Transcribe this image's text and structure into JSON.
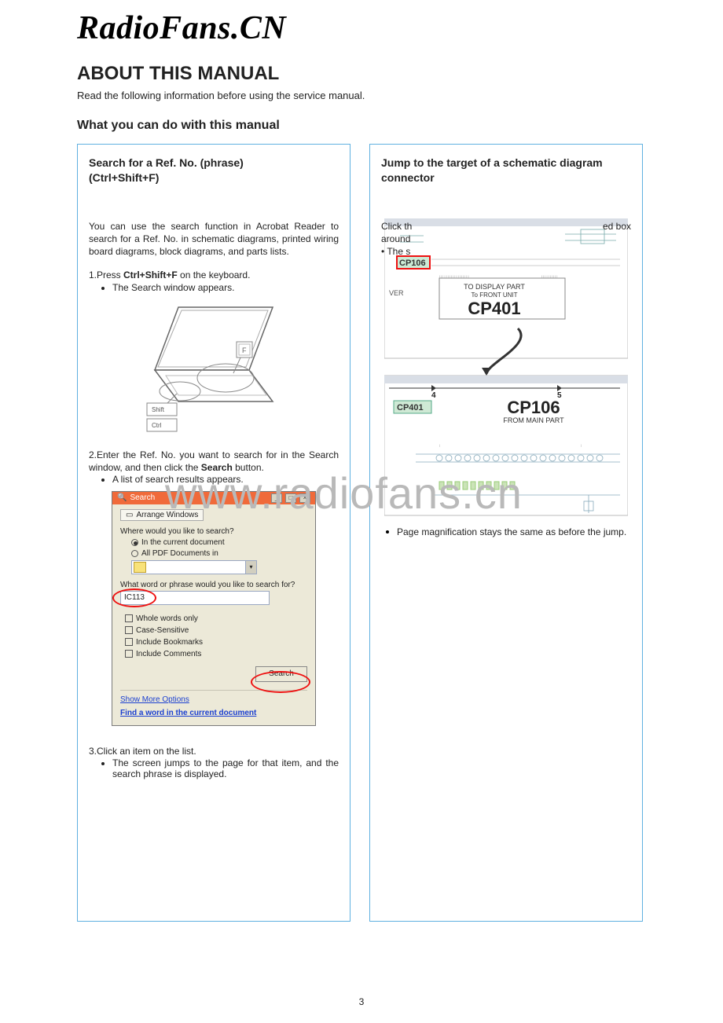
{
  "watermark_top": "RadioFans.CN",
  "watermark_mid": "www.radiofans.cn",
  "section_title": "ABOUT THIS MANUAL",
  "intro": "Read the following information before using the service manual.",
  "sub_title": "What you can do with this manual",
  "page_number": "3",
  "left": {
    "title_line1": "Search for a Ref. No. (phrase)",
    "title_line2": "(Ctrl+Shift+F)",
    "para1": "You can use the search function in Acrobat Reader to search for a Ref. No. in schematic diagrams, printed wiring board diagrams, block diagrams, and parts lists.",
    "step1_prefix": "1.Press ",
    "step1_kbd": "Ctrl+Shift+F",
    "step1_suffix": " on the keyboard.",
    "step1_bullet": "The Search window appears.",
    "laptop": {
      "key_shift": "Shift",
      "key_ctrl": "Ctrl"
    },
    "step2_prefix": "2.Enter the Ref. No. you want to search for in the Search window, and then click the ",
    "step2_bold": "Search",
    "step2_suffix": " button.",
    "step2_bullet": "A list of search results appears.",
    "dialog": {
      "title": "Search",
      "arrange": "Arrange Windows",
      "where_label": "Where would you like to search?",
      "opt_current": "In the current document",
      "opt_allpdf": "All PDF Documents in",
      "phrase_label": "What word or phrase would you like to search for?",
      "input_value": "IC113",
      "chk_whole": "Whole words only",
      "chk_case": "Case-Sensitive",
      "chk_bookmarks": "Include Bookmarks",
      "chk_comments": "Include Comments",
      "search_btn": "Search",
      "link_more": "Show More Options",
      "link_find": "Find a word in the current document"
    },
    "step3": "3.Click an item on the list.",
    "step3_bullet": "The screen jumps to the page for that item, and the search phrase is displayed."
  },
  "right": {
    "title": "Jump to the target of a schematic diagram connector",
    "line1_a": "Click th",
    "line1_b": "ed box",
    "line2": "around",
    "line3": "•  The s",
    "schematic": {
      "cp106_src": "CP106",
      "ver": "VER",
      "to_display": "TO DISPLAY PART",
      "to_front": "To FRONT UNIT",
      "cp401_big": "CP401",
      "num4": "4",
      "num5": "5",
      "cp401_small": "CP401",
      "cp106_big": "CP106",
      "from_main": "FROM MAIN PART"
    },
    "note": "Page magnification stays the same as before the jump."
  }
}
